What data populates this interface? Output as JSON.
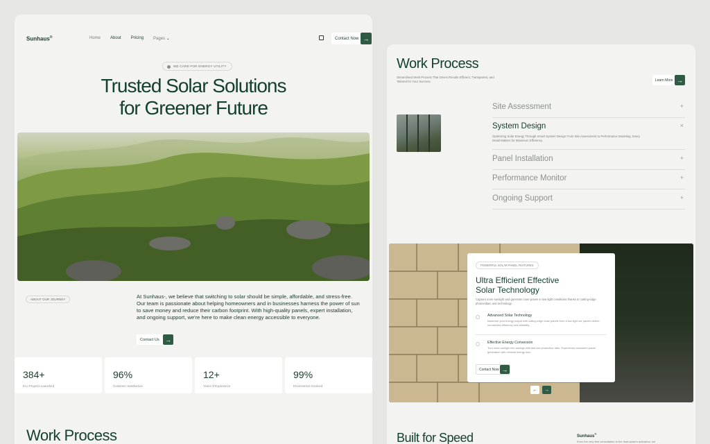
{
  "left": {
    "logo": "Sunhaus",
    "logo_mark": "®",
    "nav": [
      "Home",
      "About",
      "Pricing",
      "Pages"
    ],
    "contact_label": "Contact Now",
    "badge": "WE CARE FOR ENERGY UTILITY",
    "hero_title_1": "Trusted Solar Solutions",
    "hero_title_2": "for Greener Future",
    "journey_badge": "ABOUT OUR JOURNEY",
    "about_text": "At Sunhaus-, we believe that switching to solar should be simple, affordable, and stress-free. Our team is passionate about helping homeowners and in businesses harness the power of sun to save money and reduce their carbon footprint. With high-quality panels, expert installation, and ongoing support, we're here to make clean energy accessible to everyone.",
    "about_btn": "Contact Us",
    "stats": [
      {
        "num": "384+",
        "label": "Eco Projects Launched"
      },
      {
        "num": "96%",
        "label": "Customer Satisfaction"
      },
      {
        "num": "12+",
        "label": "Years of Experience"
      },
      {
        "num": "99%",
        "label": "Environment Involved"
      }
    ],
    "work_process_title": "Work Process"
  },
  "right": {
    "title": "Work Process",
    "subtitle": "Streamlined Work Process That Drives Results Efficient, Transparent, and Tailored for Your Success.",
    "learn_more": "Learn More",
    "accordion": [
      {
        "title": "Site Assessment",
        "sign": "+"
      },
      {
        "title": "System Design",
        "sign": "×",
        "desc": "Optimizing Solar Energy Through Smart System Design From Site Assessment to Performance Modeling, Every Detail Matters for Maximum Efficiency."
      },
      {
        "title": "Panel Installation",
        "sign": "+"
      },
      {
        "title": "Performance Monitor",
        "sign": "+"
      },
      {
        "title": "Ongoing Support",
        "sign": "+"
      }
    ],
    "card": {
      "badge": "POWERFUL SOLAR PANEL FEATURES",
      "title_1": "Ultra Efficient Effective",
      "title_2": "Solar Technology",
      "subtitle": "Capture more sunlight and generate more power in low-light conditions thanks to cutting-edge photovoltaic and technology.",
      "features": [
        {
          "title": "Advanced Solar Technology",
          "desc": "Maximize your energy output with cutting-edge solar panels from a low-light our panels deliver unmatched efficiency and reliability."
        },
        {
          "title": "Effective Energy Conversion",
          "desc": "Turn more sunlight into savings with fast-low production ratio. Experience consistent power generation with minimal energy loss."
        }
      ],
      "button": "Contact Now"
    },
    "bottom_title": "Built for Speed",
    "bottom_logo": "Sunhaus",
    "bottom_text": "Even the very first consultation to the final system activation, we"
  },
  "icons": {
    "arrow": "→",
    "prev": "←",
    "chevron": "⌄"
  },
  "colors": {
    "accent": "#2f5b45",
    "heading": "#14402f"
  }
}
